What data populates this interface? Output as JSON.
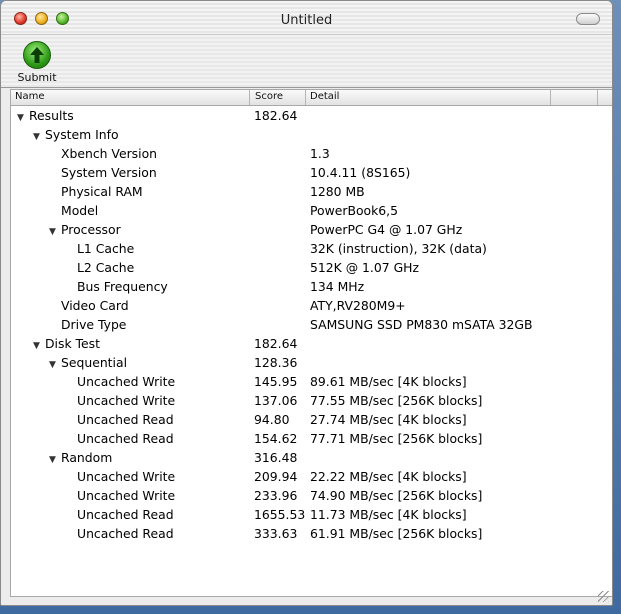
{
  "window": {
    "title": "Untitled"
  },
  "toolbar": {
    "submit_label": "Submit"
  },
  "table": {
    "headers": {
      "name": "Name",
      "score": "Score",
      "detail": "Detail"
    },
    "rows": [
      {
        "name": "Results",
        "score": "182.64",
        "detail": "",
        "level": 0,
        "expanded": true
      },
      {
        "name": "System Info",
        "score": "",
        "detail": "",
        "level": 1,
        "expanded": true
      },
      {
        "name": "Xbench Version",
        "score": "",
        "detail": "1.3",
        "level": 2
      },
      {
        "name": "System Version",
        "score": "",
        "detail": "10.4.11 (8S165)",
        "level": 2
      },
      {
        "name": "Physical RAM",
        "score": "",
        "detail": "1280 MB",
        "level": 2
      },
      {
        "name": "Model",
        "score": "",
        "detail": "PowerBook6,5",
        "level": 2
      },
      {
        "name": "Processor",
        "score": "",
        "detail": "PowerPC G4 @ 1.07 GHz",
        "level": 2,
        "expanded": true
      },
      {
        "name": "L1 Cache",
        "score": "",
        "detail": "32K (instruction), 32K (data)",
        "level": 3
      },
      {
        "name": "L2 Cache",
        "score": "",
        "detail": "512K @ 1.07 GHz",
        "level": 3
      },
      {
        "name": "Bus Frequency",
        "score": "",
        "detail": "134 MHz",
        "level": 3
      },
      {
        "name": "Video Card",
        "score": "",
        "detail": "ATY,RV280M9+",
        "level": 2
      },
      {
        "name": "Drive Type",
        "score": "",
        "detail": "SAMSUNG SSD PM830 mSATA 32GB",
        "level": 2
      },
      {
        "name": "Disk Test",
        "score": "182.64",
        "detail": "",
        "level": 1,
        "expanded": true
      },
      {
        "name": "Sequential",
        "score": "128.36",
        "detail": "",
        "level": 2,
        "expanded": true
      },
      {
        "name": "Uncached Write",
        "score": "145.95",
        "detail": "89.61 MB/sec [4K blocks]",
        "level": 3
      },
      {
        "name": "Uncached Write",
        "score": "137.06",
        "detail": "77.55 MB/sec [256K blocks]",
        "level": 3
      },
      {
        "name": "Uncached Read",
        "score": "94.80",
        "detail": "27.74 MB/sec [4K blocks]",
        "level": 3
      },
      {
        "name": "Uncached Read",
        "score": "154.62",
        "detail": "77.71 MB/sec [256K blocks]",
        "level": 3
      },
      {
        "name": "Random",
        "score": "316.48",
        "detail": "",
        "level": 2,
        "expanded": true
      },
      {
        "name": "Uncached Write",
        "score": "209.94",
        "detail": "22.22 MB/sec [4K blocks]",
        "level": 3
      },
      {
        "name": "Uncached Write",
        "score": "233.96",
        "detail": "74.90 MB/sec [256K blocks]",
        "level": 3
      },
      {
        "name": "Uncached Read",
        "score": "1655.53",
        "detail": "11.73 MB/sec [4K blocks]",
        "level": 3
      },
      {
        "name": "Uncached Read",
        "score": "333.63",
        "detail": "61.91 MB/sec [256K blocks]",
        "level": 3
      }
    ]
  }
}
